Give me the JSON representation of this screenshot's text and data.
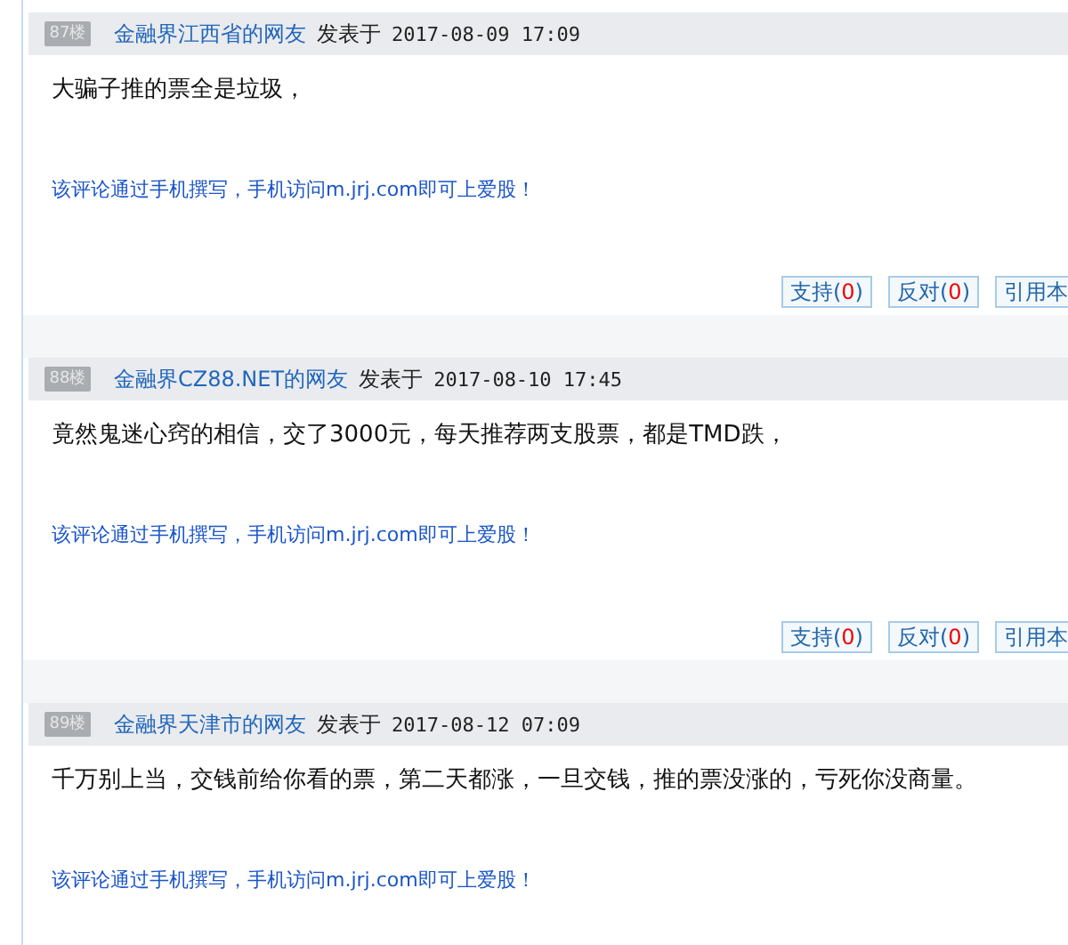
{
  "posts": [
    {
      "floor": "87楼",
      "user": "金融界江西省的网友",
      "posted_label": "发表于",
      "time": "2017-08-09 17:09",
      "content": "大骗子推的票全是垃圾，",
      "mobile_note": "该评论通过手机撰写，手机访问m.jrj.com即可上爱股！",
      "support_label": "支持(",
      "support_count": "0",
      "support_close": ")",
      "oppose_label": "反对(",
      "oppose_count": "0",
      "oppose_close": ")",
      "quote_label": "引用本"
    },
    {
      "floor": "88楼",
      "user": "金融界CZ88.NET的网友",
      "posted_label": "发表于",
      "time": "2017-08-10 17:45",
      "content": "竟然鬼迷心窍的相信，交了3000元，每天推荐两支股票，都是TMD跌，",
      "mobile_note": "该评论通过手机撰写，手机访问m.jrj.com即可上爱股！",
      "support_label": "支持(",
      "support_count": "0",
      "support_close": ")",
      "oppose_label": "反对(",
      "oppose_count": "0",
      "oppose_close": ")",
      "quote_label": "引用本"
    },
    {
      "floor": "89楼",
      "user": "金融界天津市的网友",
      "posted_label": "发表于",
      "time": "2017-08-12 07:09",
      "content": "千万别上当，交钱前给你看的票，第二天都涨，一旦交钱，推的票没涨的，亏死你没商量。",
      "mobile_note": "该评论通过手机撰写，手机访问m.jrj.com即可上爱股！"
    }
  ]
}
